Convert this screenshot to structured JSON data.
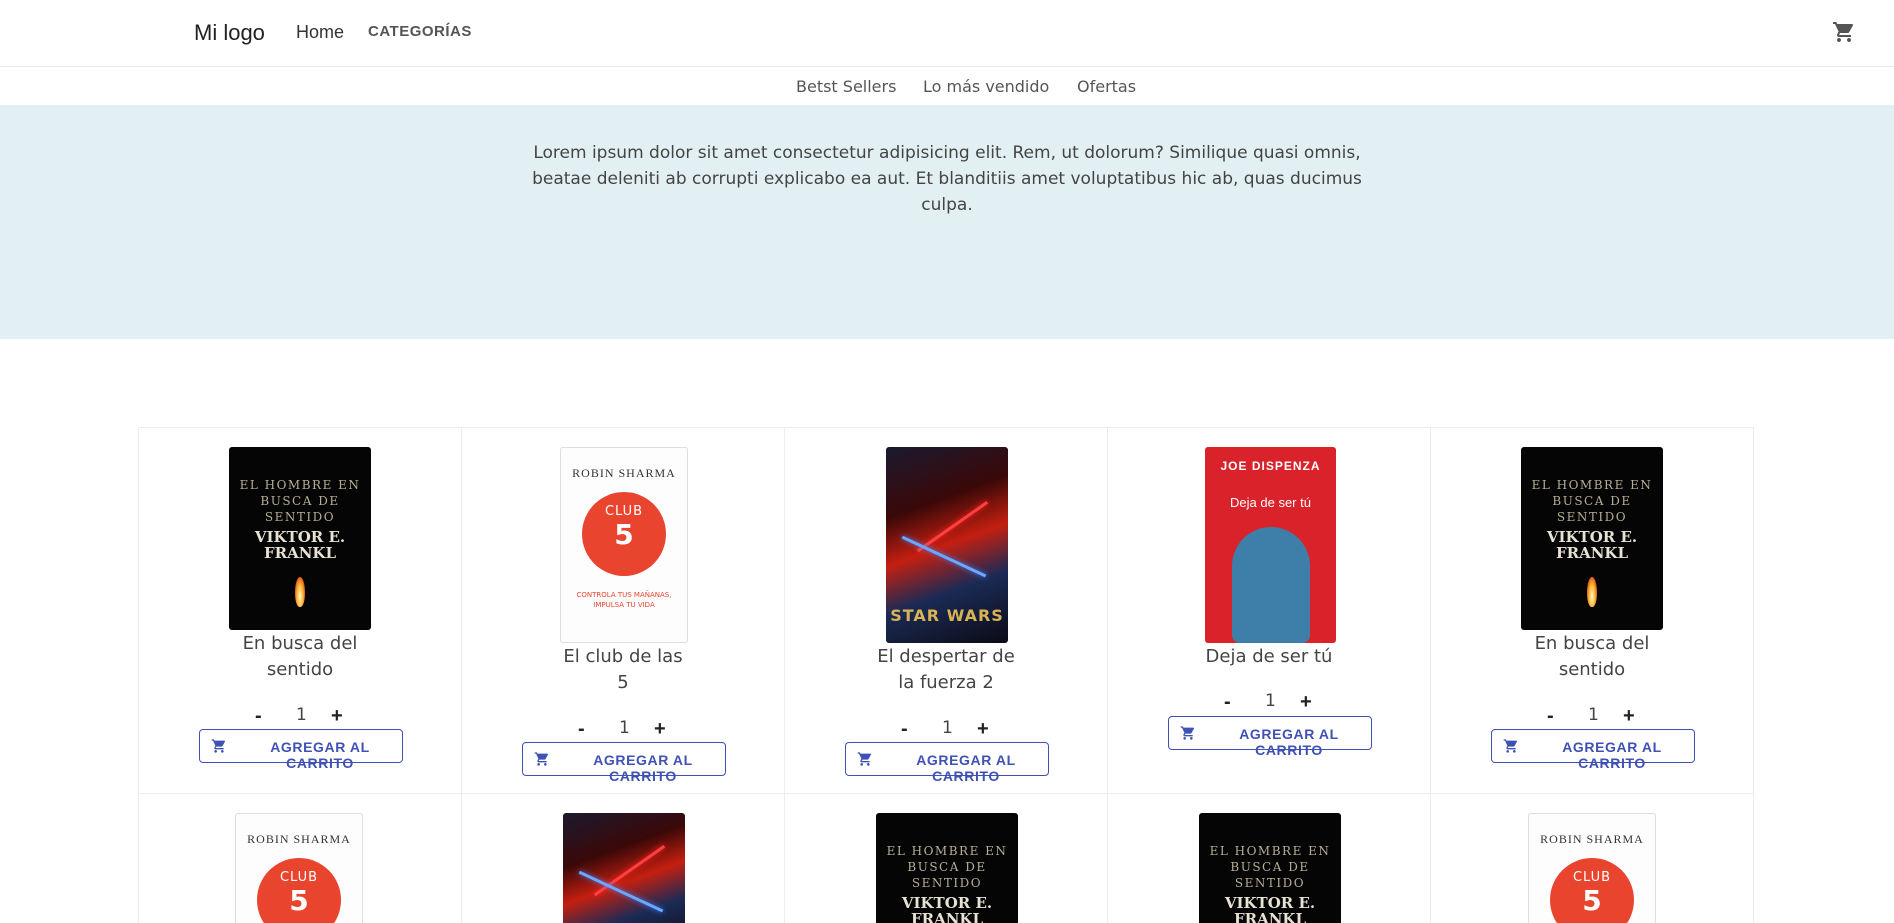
{
  "header": {
    "logo": "Mi logo",
    "nav_home": "Home",
    "nav_categories": "CATEGORÍAS",
    "cart_icon": "shopping-cart-icon"
  },
  "subnav": {
    "items": [
      "Betst Sellers",
      "Lo más vendido",
      "Ofertas"
    ]
  },
  "hero": {
    "text": "Lorem ipsum dolor sit amet consectetur adipisicing elit. Rem, ut dolorum? Similique quasi omnis, beatae deleniti ab corrupti explicabo ea aut. Et blanditiis amet voluptatibus hic ab, quas ducimus culpa."
  },
  "colors": {
    "hero_bg": "#e3f0f3",
    "button_accent": "#3f51b5"
  },
  "products": [
    {
      "title": "En busca del sentido",
      "qty": "1",
      "minus": "-",
      "plus": "+",
      "button": "AGREGAR AL CARRITO",
      "cover": "frankl",
      "cover_text": {
        "l1": "EL HOMBRE EN BUSCA DE SENTIDO",
        "l2": "VIKTOR E. FRANKL"
      }
    },
    {
      "title": "El club de las 5",
      "qty": "1",
      "minus": "-",
      "plus": "+",
      "button": "AGREGAR AL CARRITO",
      "cover": "club",
      "cover_text": {
        "auth": "ROBIN SHARMA",
        "c1": "CLUB",
        "c2": "5",
        "sub": "CONTROLA TUS MAÑANAS, IMPULSA TU VIDA"
      }
    },
    {
      "title": "El despertar de la fuerza 2",
      "qty": "1",
      "minus": "-",
      "plus": "+",
      "button": "AGREGAR AL CARRITO",
      "cover": "starwars",
      "cover_text": {
        "logo": "STAR WARS"
      }
    },
    {
      "title": "Deja de ser tú",
      "qty": "1",
      "minus": "-",
      "plus": "+",
      "button": "AGREGAR AL CARRITO",
      "cover": "dispenza",
      "cover_text": {
        "auth": "JOE DISPENZA",
        "t": "Deja de ser tú"
      }
    },
    {
      "title": "En busca del sentido",
      "qty": "1",
      "minus": "-",
      "plus": "+",
      "button": "AGREGAR AL CARRITO",
      "cover": "frankl",
      "cover_text": {
        "l1": "EL HOMBRE EN BUSCA DE SENTIDO",
        "l2": "VIKTOR E. FRANKL"
      }
    }
  ],
  "products_row2": [
    {
      "cover": "club",
      "cover_text": {
        "auth": "ROBIN SHARMA",
        "c1": "CLUB",
        "c2": "5"
      }
    },
    {
      "cover": "starwars",
      "cover_text": {
        "logo": ""
      }
    },
    {
      "cover": "frankl",
      "cover_text": {
        "l1": "EL HOMBRE EN BUSCA DE SENTIDO",
        "l2": "VIKTOR E. FRANKL"
      }
    },
    {
      "cover": "frankl",
      "cover_text": {
        "l1": "EL HOMBRE EN BUSCA DE SENTIDO",
        "l2": "VIKTOR E. FRANKL"
      }
    },
    {
      "cover": "club",
      "cover_text": {
        "auth": "ROBIN SHARMA",
        "c1": "CLUB",
        "c2": "5"
      }
    }
  ]
}
